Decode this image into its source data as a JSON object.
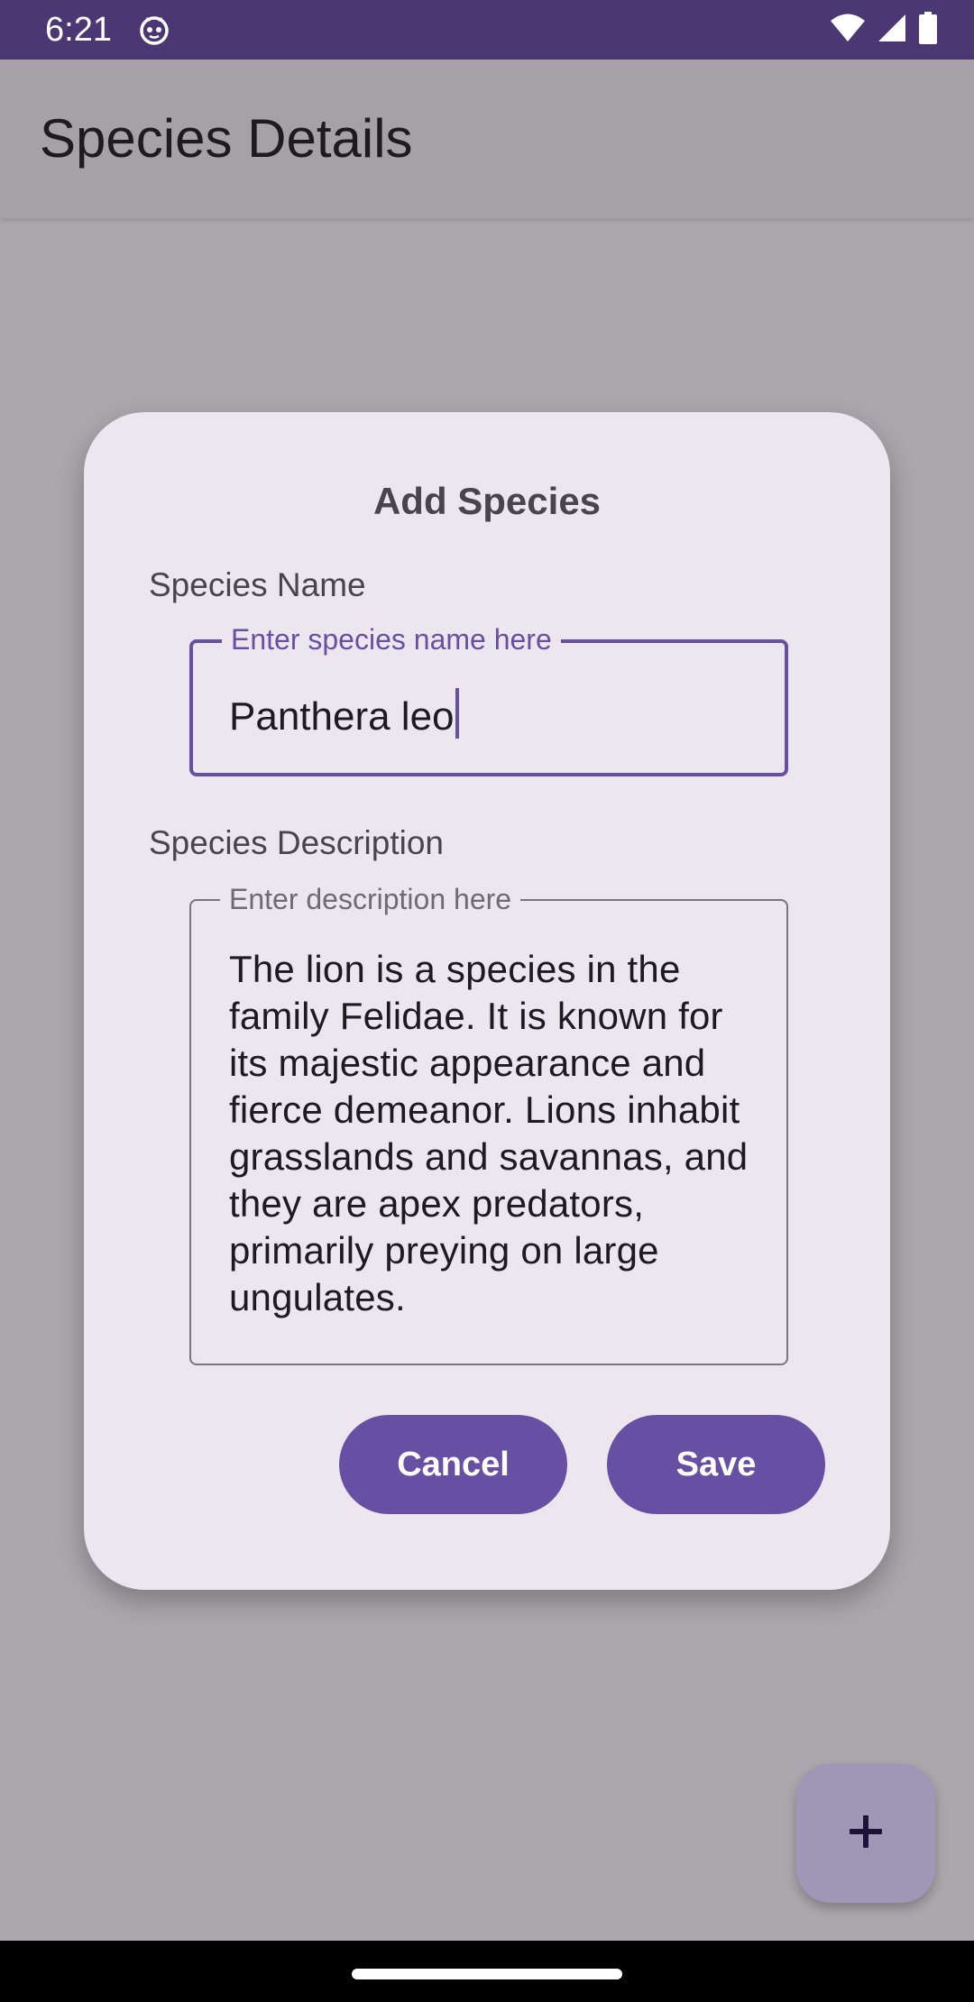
{
  "status_bar": {
    "time": "6:21",
    "app_icon": "cat-face-icon",
    "wifi_icon": "wifi-icon",
    "signal_icon": "cell-signal-icon",
    "battery_icon": "battery-icon"
  },
  "app_bar": {
    "title": "Species Details"
  },
  "dialog": {
    "title": "Add Species",
    "name_section": {
      "label": "Species Name",
      "placeholder": "Enter species name here",
      "value": "Panthera leo"
    },
    "description_section": {
      "label": "Species Description",
      "placeholder": "Enter description here",
      "value": "The lion is a species in the family Felidae. It is known for its majestic appearance and fierce demeanor. Lions inhabit grasslands and savannas, and they are apex predators, primarily preying on large ungulates."
    },
    "buttons": {
      "cancel": "Cancel",
      "save": "Save"
    }
  },
  "fab": {
    "icon": "plus-icon"
  },
  "colors": {
    "primary": "#6750a4",
    "status_bar": "#4b3774",
    "dialog_surface": "#ece6ef",
    "scrim": "#aca7ad"
  }
}
